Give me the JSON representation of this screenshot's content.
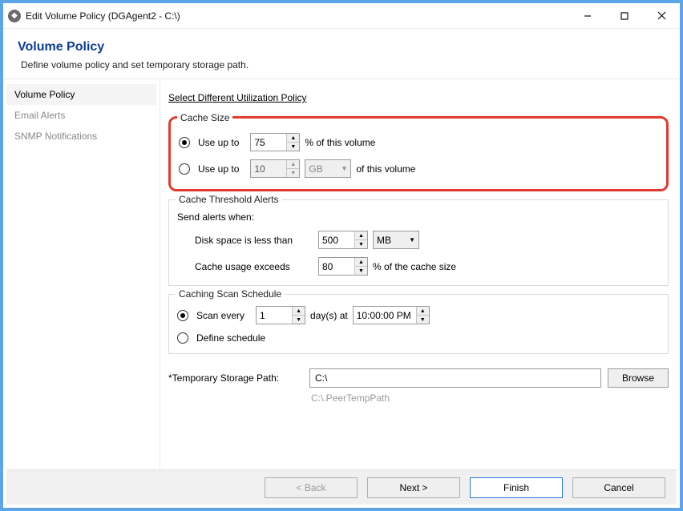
{
  "window": {
    "title": "Edit Volume Policy (DGAgent2 - C:\\)"
  },
  "heading": {
    "title": "Volume Policy",
    "subtitle": "Define volume policy and set temporary storage path."
  },
  "sidebar": {
    "items": [
      {
        "label": "Volume Policy",
        "active": true
      },
      {
        "label": "Email Alerts"
      },
      {
        "label": "SNMP Notifications"
      }
    ]
  },
  "main": {
    "policy_link": "Select Different Utilization Policy",
    "cache_size": {
      "legend": "Cache Size",
      "opt_percent": {
        "label": "Use up to",
        "value": "75",
        "suffix": "% of this volume",
        "checked": true
      },
      "opt_absolute": {
        "label": "Use up to",
        "value": "10",
        "unit": "GB",
        "suffix": "of this volume",
        "checked": false
      }
    },
    "threshold": {
      "legend": "Cache Threshold Alerts",
      "intro": "Send alerts when:",
      "disk_label": "Disk space is less than",
      "disk_value": "500",
      "disk_unit": "MB",
      "usage_label": "Cache usage exceeds",
      "usage_value": "80",
      "usage_suffix": "% of the cache size"
    },
    "schedule": {
      "legend": "Caching Scan Schedule",
      "every_label": "Scan every",
      "every_value": "1",
      "every_unit": "day(s) at",
      "every_time": "10:00:00 PM",
      "every_checked": true,
      "define_label": "Define schedule",
      "define_checked": false
    },
    "path": {
      "label": "*Temporary Storage Path:",
      "value": "C:\\",
      "browse": "Browse",
      "hint": "C:\\.PeerTempPath"
    }
  },
  "footer": {
    "back": "< Back",
    "next": "Next >",
    "finish": "Finish",
    "cancel": "Cancel"
  }
}
